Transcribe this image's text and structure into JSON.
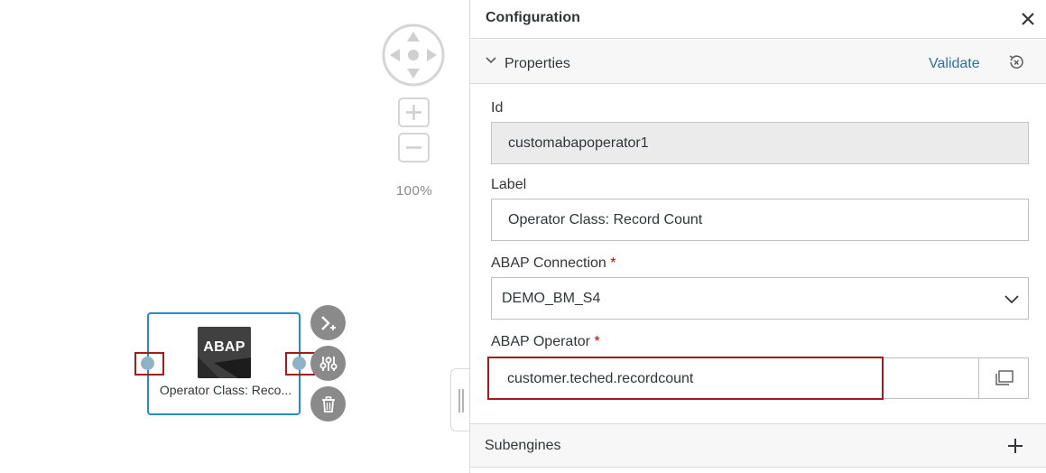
{
  "canvas": {
    "zoom_level": "100%",
    "node": {
      "logo_text": "ABAP",
      "label": "Operator Class: Reco..."
    },
    "actions": [
      {
        "icon": "terminal-add-icon"
      },
      {
        "icon": "sliders-icon"
      },
      {
        "icon": "trash-icon"
      }
    ]
  },
  "panel": {
    "title": "Configuration",
    "section": {
      "title": "Properties",
      "validate_label": "Validate"
    },
    "fields": {
      "id_label": "Id",
      "id_value": "customabapoperator1",
      "label_label": "Label",
      "label_value": "Operator Class: Record Count",
      "connection_label": "ABAP Connection",
      "connection_value": "DEMO_BM_S4",
      "operator_label": "ABAP Operator",
      "operator_value": "customer.teched.recordcount",
      "required_marker": "*"
    },
    "subengines_label": "Subengines"
  },
  "colors": {
    "accent": "#2a8bc4",
    "link": "#2f6fa6",
    "highlight": "#a01d1d",
    "required": "#bb0000"
  }
}
